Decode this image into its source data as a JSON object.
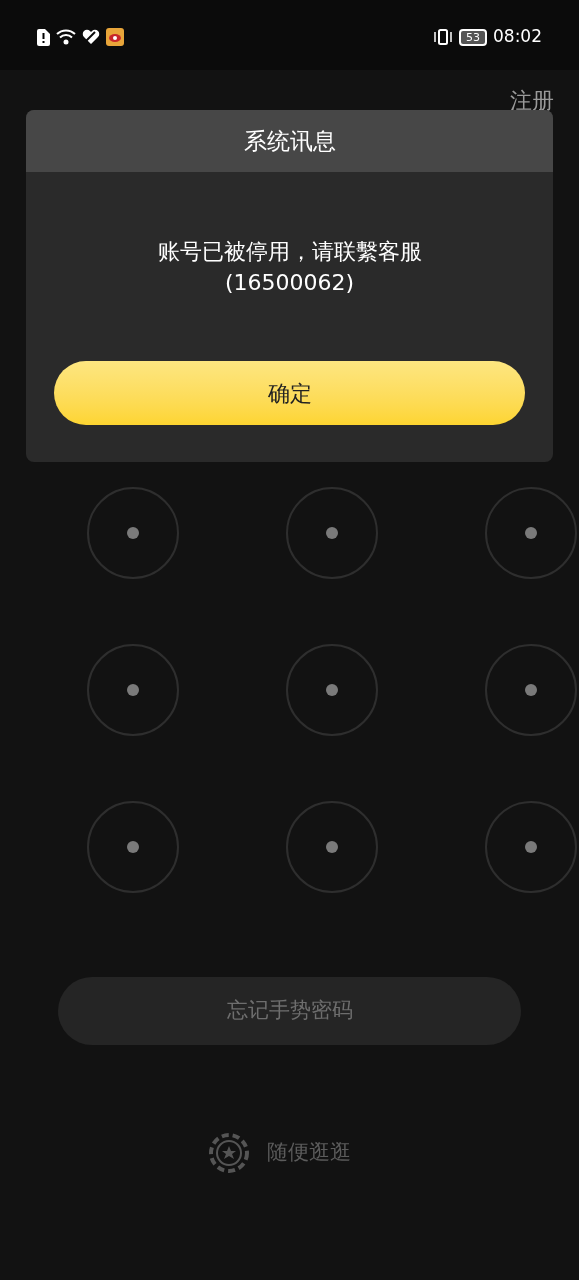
{
  "status_bar": {
    "battery": "53",
    "time": "08:02"
  },
  "header": {
    "register_link": "注册"
  },
  "dialog": {
    "title": "系统讯息",
    "message": "账号已被停用，请联繫客服",
    "code": "(16500062)",
    "confirm_button": "确定"
  },
  "forgot_button": "忘记手势密码",
  "browse_link": "随便逛逛"
}
